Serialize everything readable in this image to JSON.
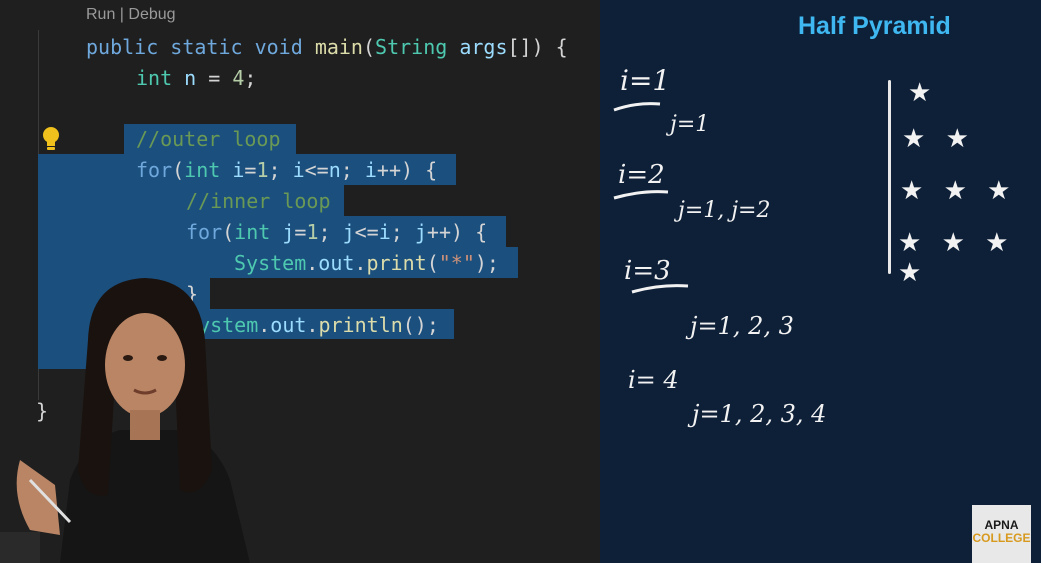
{
  "editor": {
    "codelens": "Run | Debug",
    "lines": {
      "l1": {
        "kw1": "public",
        "kw2": "static",
        "kw3": "void",
        "fn": "main",
        "p1": "(",
        "ty": "String",
        "var": "args",
        "p2": "[]) {"
      },
      "l2": {
        "kw": "int",
        "var": "n",
        "op": " = ",
        "num": "4",
        "p": ";"
      },
      "l3": {
        "comment": "//outer loop"
      },
      "l4": {
        "kw": "for",
        "p1": "(",
        "kw2": "int",
        "var1": "i",
        "op1": "=",
        "num1": "1",
        "p2": "; ",
        "var2": "i",
        "op2": "<=",
        "var3": "n",
        "p3": "; ",
        "var4": "i",
        "op3": "++) {"
      },
      "l5": {
        "comment": "//inner loop"
      },
      "l6": {
        "kw": "for",
        "p1": "(",
        "kw2": "int",
        "var1": "j",
        "op1": "=",
        "num1": "1",
        "p2": "; ",
        "var2": "j",
        "op2": "<=",
        "var3": "i",
        "p3": "; ",
        "var4": "j",
        "op3": "++) {"
      },
      "l7": {
        "cls": "System",
        "dot1": ".",
        "field": "out",
        "dot2": ".",
        "fn": "print",
        "p1": "(",
        "str": "\"*\"",
        "p2": ");"
      },
      "l8": {
        "brace": "}"
      },
      "l9": {
        "cls": "System",
        "dot1": ".",
        "field": "out",
        "dot2": ".",
        "fn": "println",
        "p": "();"
      },
      "l10": {
        "brace": "}"
      }
    }
  },
  "whiteboard": {
    "title": "Half Pyramid",
    "notes": {
      "i1": "i=1",
      "j1": "j=1",
      "i2": "i=2",
      "j2": "j=1, j=2",
      "i3": "i=3",
      "j3": "j=1, 2, 3",
      "i4": "i= 4",
      "j4": "j=1, 2, 3, 4"
    },
    "stars": [
      "★",
      "★ ★",
      "★ ★ ★",
      "★ ★ ★ ★"
    ]
  },
  "logo": {
    "line1": "APNA",
    "line2": "COLLEGE"
  },
  "colors": {
    "editor_bg": "#1f1f1f",
    "selection": "#1b4f7e",
    "whiteboard_bg": "#0e2038",
    "title": "#3fb8f2",
    "logo_accent": "#d89a1e"
  }
}
